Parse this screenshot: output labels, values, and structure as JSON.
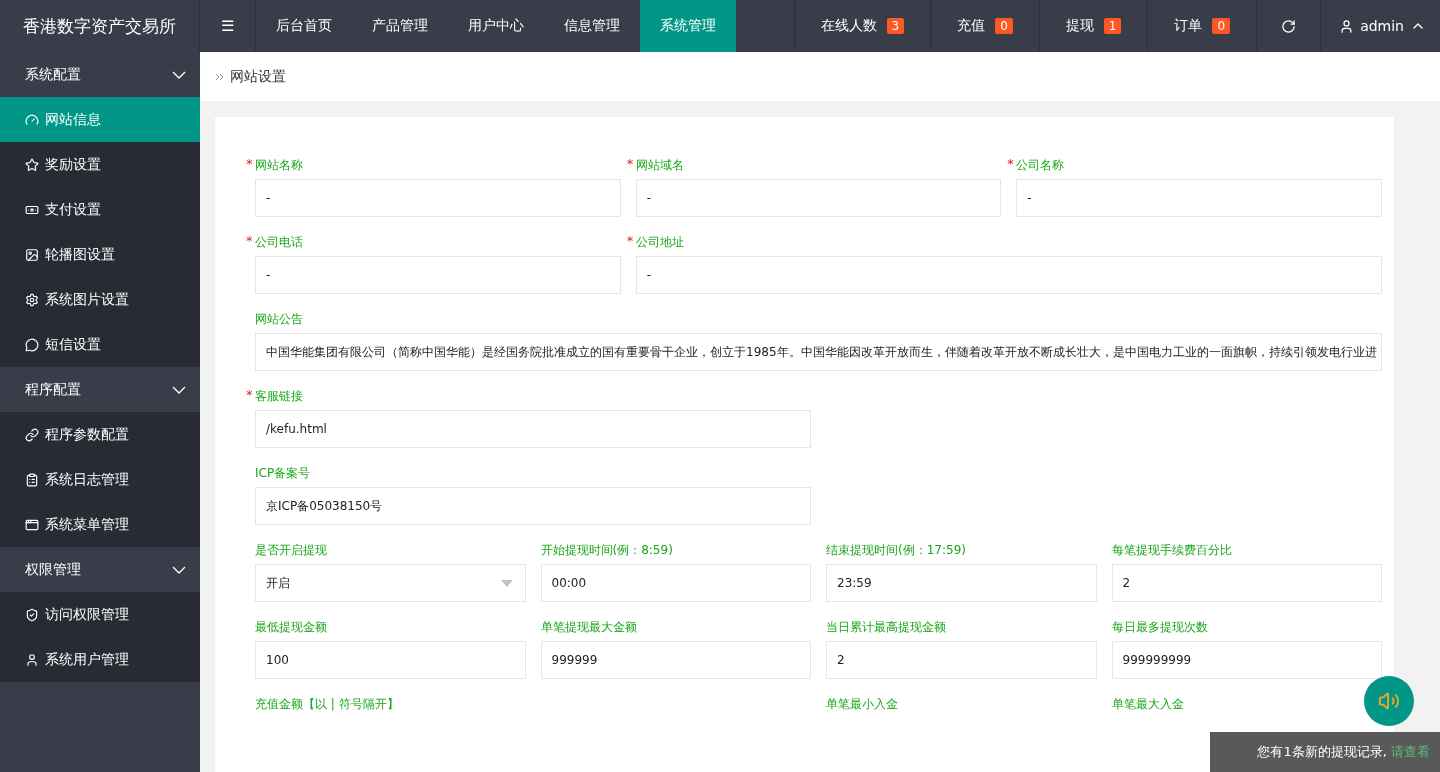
{
  "header": {
    "logo": "香港数字资产交易所",
    "menu_toggle": "☰",
    "nav": [
      {
        "label": "后台首页",
        "selected": false
      },
      {
        "label": "产品管理",
        "selected": false
      },
      {
        "label": "用户中心",
        "selected": false
      },
      {
        "label": "信息管理",
        "selected": false
      },
      {
        "label": "系统管理",
        "selected": true
      }
    ],
    "counters": [
      {
        "label": "在线人数",
        "badge": "3"
      },
      {
        "label": "充值",
        "badge": "0"
      },
      {
        "label": "提现",
        "badge": "1"
      },
      {
        "label": "订单",
        "badge": "0"
      }
    ],
    "user": "admin"
  },
  "sidebar": [
    {
      "label": "系统配置",
      "expanded": true,
      "children": [
        {
          "label": "网站信息",
          "selected": true
        },
        {
          "label": "奖励设置",
          "selected": false
        },
        {
          "label": "支付设置",
          "selected": false
        },
        {
          "label": "轮播图设置",
          "selected": false
        },
        {
          "label": "系统图片设置",
          "selected": false
        },
        {
          "label": "短信设置",
          "selected": false
        }
      ]
    },
    {
      "label": "程序配置",
      "expanded": true,
      "children": [
        {
          "label": "程序参数配置",
          "selected": false
        },
        {
          "label": "系统日志管理",
          "selected": false
        },
        {
          "label": "系统菜单管理",
          "selected": false
        }
      ]
    },
    {
      "label": "权限管理",
      "expanded": true,
      "children": [
        {
          "label": "访问权限管理",
          "selected": false
        },
        {
          "label": "系统用户管理",
          "selected": false
        }
      ]
    }
  ],
  "breadcrumb": "网站设置",
  "required_mark": "*",
  "form": [
    [
      {
        "label": "网站名称",
        "required": true,
        "value": "-",
        "kind": "input"
      },
      {
        "label": "网站域名",
        "required": true,
        "value": "-",
        "kind": "input"
      },
      {
        "label": "公司名称",
        "required": true,
        "value": "-",
        "kind": "input"
      }
    ],
    [
      {
        "label": "公司电话",
        "required": true,
        "value": "-",
        "kind": "input"
      },
      {
        "label": "公司地址",
        "required": true,
        "value": "-",
        "kind": "input"
      }
    ],
    [
      {
        "label": "网站公告",
        "value": "中国华能集团有限公司（简称中国华能）是经国务院批准成立的国有重要骨干企业，创立于1985年。中国华能因改革开放而生，伴随着改革开放不断成长壮大，是中国电力工业的一面旗帜，持续引领发电行业进",
        "kind": "input"
      }
    ],
    [
      {
        "label": "客服链接",
        "required": true,
        "value": "/kefu.html",
        "kind": "input"
      }
    ],
    [
      {
        "label": "ICP备案号",
        "value": "京ICP备05038150号",
        "kind": "input"
      }
    ],
    [
      {
        "label": "是否开启提现",
        "value": "开启",
        "kind": "select"
      },
      {
        "label": "开始提现时间(例：8:59)",
        "value": "00:00",
        "kind": "input"
      },
      {
        "label": "结束提现时间(例：17:59)",
        "value": "23:59",
        "kind": "input"
      },
      {
        "label": "每笔提现手续费百分比",
        "value": "2",
        "kind": "input"
      }
    ],
    [
      {
        "label": "最低提现金额",
        "value": "100",
        "kind": "input"
      },
      {
        "label": "单笔提现最大金额",
        "value": "999999",
        "kind": "input"
      },
      {
        "label": "当日累计最高提现金额",
        "value": "2",
        "kind": "input"
      },
      {
        "label": "每日最多提现次数",
        "value": "999999999",
        "kind": "input"
      }
    ],
    [
      {
        "label": "充值金额【以 | 符号隔开】",
        "kind": "label"
      },
      {
        "label": "单笔最小入金",
        "kind": "label"
      },
      {
        "label": "单笔最大入金",
        "kind": "label"
      }
    ]
  ],
  "toast": {
    "message": "您有1条新的提现记录, ",
    "link": "请查看"
  }
}
